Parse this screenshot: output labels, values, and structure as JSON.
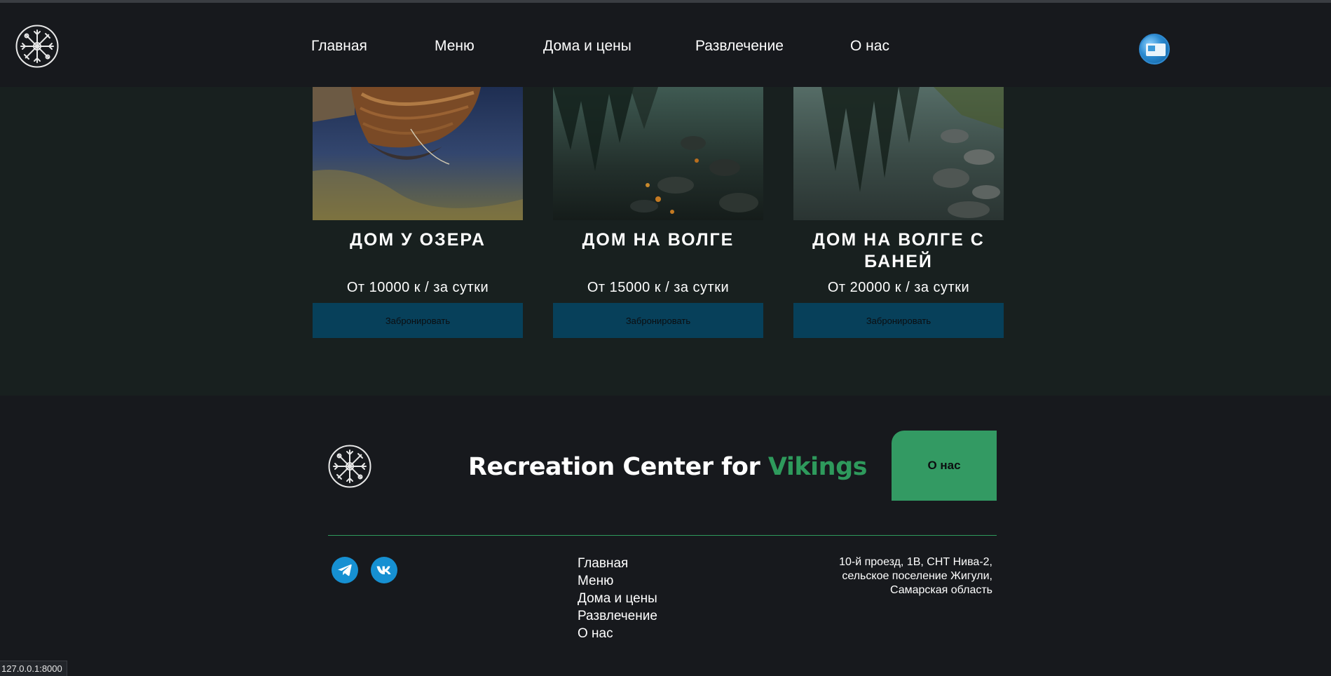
{
  "header": {
    "logo_icon": "vegvisir-icon",
    "nav": [
      "Главная",
      "Меню",
      "Дома и цены",
      "Развлечение",
      "О нас"
    ],
    "avatar_icon": "user-avatar-icon"
  },
  "houses": [
    {
      "title": "ДОМ У ОЗЕРА",
      "price": "От 10000 к / за сутки",
      "button": "Забронировать",
      "image": "viking-boat-photo"
    },
    {
      "title": "ДОМ НА ВОЛГЕ",
      "price": "От 15000 к / за сутки",
      "button": "Забронировать",
      "image": "forest-lake-reflection-photo"
    },
    {
      "title": "ДОМ НА ВОЛГЕ С БАНЕЙ",
      "price": "От 20000 к / за сутки",
      "button": "Забронировать",
      "image": "lake-stones-reflection-photo"
    }
  ],
  "footer": {
    "brand_text": "Recreation Center for ",
    "brand_accent": "Vikings",
    "about_button": "О нас",
    "social": [
      "telegram-icon",
      "vk-icon"
    ],
    "nav": [
      "Главная",
      "Меню",
      "Дома и цены",
      "Развлечение",
      "О нас"
    ],
    "address": [
      "10-й проезд, 1В, СНТ Нива-2,",
      "сельское поселение Жигули,",
      "Самарская область"
    ]
  },
  "status_url": "127.0.0.1:8000",
  "colors": {
    "background": "#17191d",
    "section": "#18201f",
    "book_button": "#07405a",
    "accent": "#2e9a5c",
    "about_button": "#339a63",
    "social": "#1690d2"
  }
}
